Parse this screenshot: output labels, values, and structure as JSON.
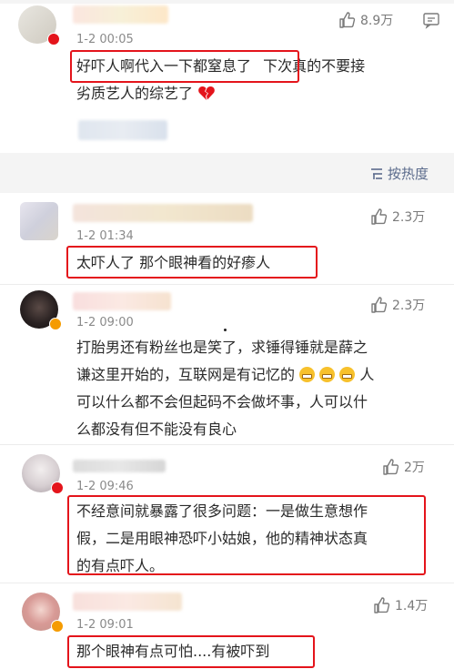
{
  "comments": [
    {
      "time": "1-2 00:05",
      "likes": "8.9万",
      "text_boxed": "好吓人啊代入一下都窒息了",
      "text_rest": "下次真的不要接",
      "text_line2": "劣质艺人的综艺了"
    },
    {
      "time": "1-2 01:34",
      "likes": "2.3万",
      "text": "太吓人了 那个眼神看的好瘆人"
    },
    {
      "time": "1-2 09:00",
      "likes": "2.3万",
      "lines": [
        "打胎男还有粉丝也是笑了，求锤得锤就是薛之",
        "谦这里开始的，互联网是有记忆的",
        "人",
        "可以什么都不会但起码不会做坏事，人可以什",
        "么都没有但不能没有良心"
      ]
    },
    {
      "time": "1-2 09:46",
      "likes": "2万",
      "lines": [
        "不经意间就暴露了很多问题：一是做生意想作",
        "假，二是用眼神恐吓小姑娘，他的精神状态真",
        "的有点吓人。"
      ]
    },
    {
      "time": "1-2 09:01",
      "likes": "1.4万",
      "text": "那个眼神有点可怕....有被吓到"
    }
  ],
  "sort_label": "按热度",
  "icons": {
    "like": "thumbs-up-icon",
    "comment": "comment-icon",
    "sort": "sort-icon",
    "heart": "broken-heart-icon",
    "grin": "grimace-emoji-icon"
  },
  "colors": {
    "highlight_box": "#e4141b",
    "verified_badge": "#f59b00",
    "weibo_red": "#e4141b"
  }
}
